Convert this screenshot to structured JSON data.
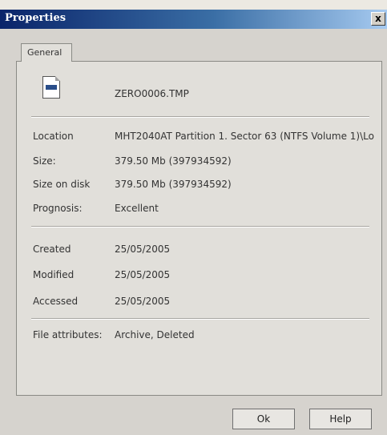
{
  "window": {
    "title": "Properties",
    "close_glyph": "x"
  },
  "tabs": [
    {
      "label": "General",
      "active": true
    }
  ],
  "file": {
    "name": "ZERO0006.TMP",
    "icon": "tmp-file-icon"
  },
  "details": {
    "location_label": "Location",
    "location_value": "MHT2040AT Partition 1. Sector 63 (NTFS Volume 1)\\Lo",
    "size_label": "Size:",
    "size_value": "379.50 Mb (397934592)",
    "size_on_disk_label": "Size on disk",
    "size_on_disk_value": "379.50 Mb (397934592)",
    "prognosis_label": "Prognosis:",
    "prognosis_value": "Excellent"
  },
  "dates": {
    "created_label": "Created",
    "created_value": "25/05/2005",
    "modified_label": "Modified",
    "modified_value": "25/05/2005",
    "accessed_label": "Accessed",
    "accessed_value": "25/05/2005"
  },
  "attributes": {
    "label": "File attributes:",
    "value": "Archive, Deleted"
  },
  "buttons": {
    "ok": "Ok",
    "help": "Help"
  },
  "colors": {
    "titlebar_start": "#0a246a",
    "titlebar_end": "#a6caf0",
    "dialog_bg": "#d6d3ce"
  }
}
